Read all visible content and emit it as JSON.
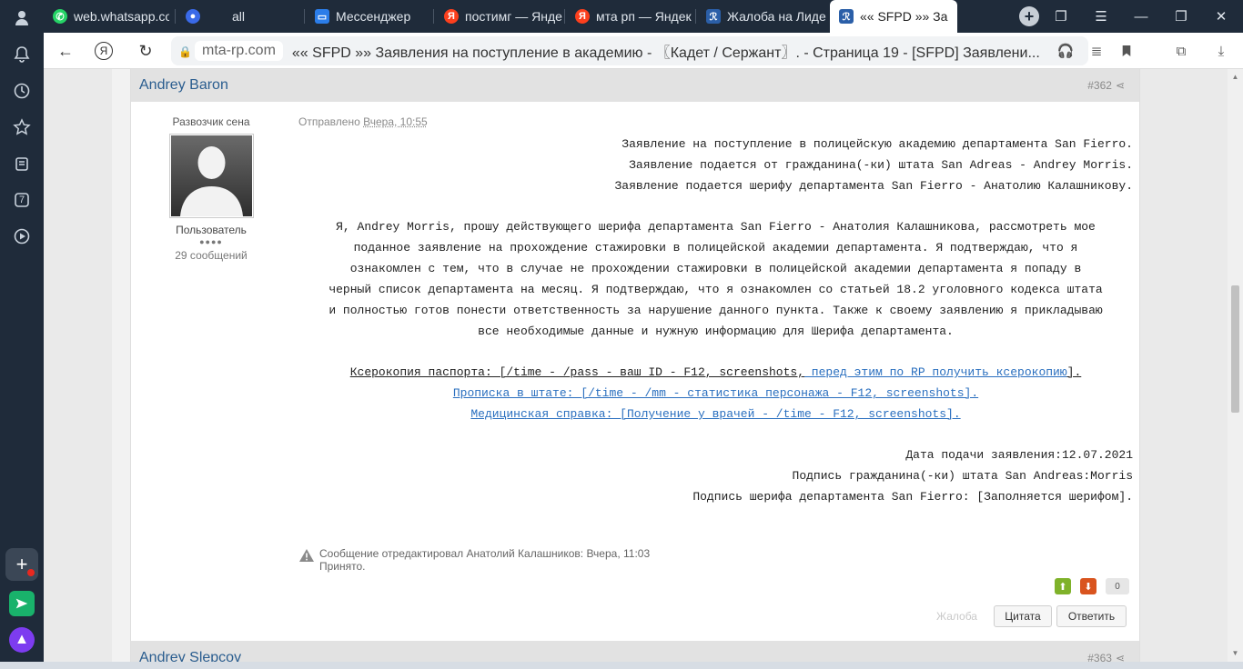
{
  "tabs": [
    {
      "label": "web.whatsapp.co",
      "icon": "whatsapp-icon",
      "color": "#25d366"
    },
    {
      "label": "all",
      "icon": "app-icon",
      "color": "#3a6ae8"
    },
    {
      "label": "Мессенджер",
      "icon": "messenger-icon",
      "color": "#2b7de9"
    },
    {
      "label": "постимг — Янде",
      "icon": "yandex-icon",
      "color": "#fc3f1d"
    },
    {
      "label": "мта рп — Яндек",
      "icon": "yandex-icon",
      "color": "#fc3f1d"
    },
    {
      "label": "Жалоба на Лиде",
      "icon": "forum-icon",
      "color": "#2b5fa8"
    },
    {
      "label": "«« SFPD »» За",
      "icon": "forum-icon",
      "color": "#2b5fa8",
      "active": true
    }
  ],
  "address": {
    "domain": "mta-rp.com",
    "title": "«« SFPD »» Заявления на поступление в академию - 〖Кадет / Сержант〗. - Страница 19 - [SFPD] Заявлени..."
  },
  "sidebar": {
    "app_count": "7",
    "accent": "#e8281f"
  },
  "post1": {
    "author": "Andrey Baron",
    "number": "#362",
    "user_title": "Развозчик сена",
    "user_role": "Пользователь",
    "rank_dots": "●●●●",
    "post_count": "29 сообщений",
    "sent_prefix": "Отправлено",
    "sent_time": "Вчера, 10:55",
    "header_lines": [
      "Заявление на поступление в полицейскую академию департамента San Fierro.",
      "Заявление подается от гражданина(-ки) штата San Adreas - Andrey Morris.",
      "Заявление подается шерифу департамента San Fierro - Анатолию Калашникову."
    ],
    "body_lines": [
      "Я, Andrey Morris, прошу действующего шерифа департамента San Fierro - Анатолия Калашникова, рассмотреть мое",
      "поданное заявление на прохождение стажировки в полицейской академии департамента.  Я подтверждаю, что я",
      "ознакомлен с тем, что в случае не прохождении стажировки в полицейской академии департамента я попаду в",
      "черный список департамента на месяц. Я подтверждаю, что я ознакомлен со статьей 18.2 уголовного кодекса штата",
      "и полностью готов понести ответственность за нарушение данного пункта. Также к своему заявлению я прикладываю",
      "все необходимые данные и нужную информацию для Шерифа департамента."
    ],
    "passport_text": "Ксерокопия паспорта: [/time - /pass - ваш ID - F12, screenshots,",
    "passport_link": " перед этим по RP получить ксерокопию",
    "passport_end": "]. ",
    "registration": "Прописка в штате: [/time - /mm - статистика персонажа - F12, screenshots].",
    "medical": "Медицинская справка: [Получение у врачей - /time - F12, screenshots].",
    "footer_lines": [
      "Дата подачи заявления:12.07.2021",
      "Подпись гражданина(-ки) штата San Andreas:Morris",
      "Подпись шерифа департамента San Fierro: [Заполняется шерифом]."
    ],
    "edit_note": "Сообщение отредактировал Анатолий Калашников: Вчера, 11:03",
    "edit_reason": "Принято.",
    "score": "0",
    "report_label": "Жалоба",
    "quote_label": "Цитата",
    "reply_label": "Ответить",
    "colors": {
      "up": "#7fb22a",
      "down": "#d9541e"
    }
  },
  "post2": {
    "author": "Andrey Slepcov",
    "number": "#363"
  }
}
